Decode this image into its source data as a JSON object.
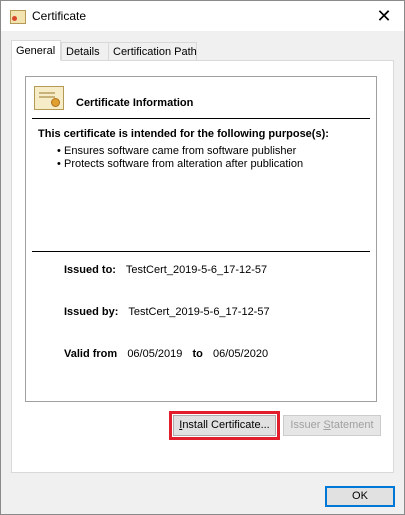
{
  "window": {
    "title": "Certificate",
    "close_glyph": "✕"
  },
  "tabs": [
    {
      "label": "General",
      "active": true
    },
    {
      "label": "Details",
      "active": false
    },
    {
      "label": "Certification Path",
      "active": false
    }
  ],
  "general": {
    "heading": "Certificate Information",
    "purpose_heading": "This certificate is intended for the following purpose(s):",
    "purposes": [
      "Ensures software came from software publisher",
      "Protects software from alteration after publication"
    ],
    "issued_to_label": "Issued to:",
    "issued_to_value": "TestCert_2019-5-6_17-12-57",
    "issued_by_label": "Issued by:",
    "issued_by_value": "TestCert_2019-5-6_17-12-57",
    "valid_from_label": "Valid from",
    "valid_from_value": "06/05/2019",
    "valid_to_label": "to",
    "valid_to_value": "06/05/2020"
  },
  "buttons": {
    "install_first": "I",
    "install_rest": "nstall Certificate...",
    "issuer_pre": "Issuer ",
    "issuer_underline": "S",
    "issuer_post": "tatement",
    "ok": "OK"
  },
  "icons": {
    "title": "certificate-icon",
    "info": "certificate-icon",
    "close": "close-icon",
    "bullet": "•"
  },
  "colors": {
    "highlight": "#e21d2c",
    "ok_border": "#0078d7"
  }
}
